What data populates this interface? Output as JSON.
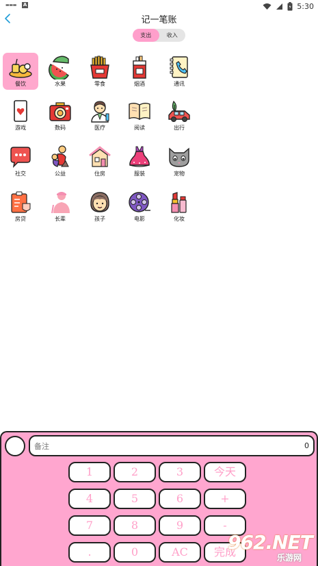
{
  "status_bar": {
    "time": "5:30",
    "left_badge": "A",
    "left_mini": "▬▬▬"
  },
  "header": {
    "title": "记一笔账"
  },
  "tabs": [
    {
      "label": "支出",
      "active": true
    },
    {
      "label": "收入",
      "active": false
    }
  ],
  "categories": [
    {
      "label": "餐饮",
      "icon": "meal-icon",
      "selected": true
    },
    {
      "label": "水果",
      "icon": "watermelon-icon",
      "selected": false
    },
    {
      "label": "零食",
      "icon": "fries-icon",
      "selected": false
    },
    {
      "label": "烟酒",
      "icon": "cigarette-icon",
      "selected": false
    },
    {
      "label": "通讯",
      "icon": "phone-book-icon",
      "selected": false
    },
    {
      "label": "游戏",
      "icon": "playing-card-icon",
      "selected": false
    },
    {
      "label": "数码",
      "icon": "camera-icon",
      "selected": false
    },
    {
      "label": "医疗",
      "icon": "doctor-icon",
      "selected": false
    },
    {
      "label": "阅读",
      "icon": "book-icon",
      "selected": false
    },
    {
      "label": "出行",
      "icon": "car-icon",
      "selected": false
    },
    {
      "label": "社交",
      "icon": "chat-bubble-icon",
      "selected": false
    },
    {
      "label": "公益",
      "icon": "charity-icon",
      "selected": false
    },
    {
      "label": "住房",
      "icon": "house-icon",
      "selected": false
    },
    {
      "label": "服装",
      "icon": "dress-icon",
      "selected": false
    },
    {
      "label": "宠物",
      "icon": "cat-icon",
      "selected": false
    },
    {
      "label": "房贷",
      "icon": "mortgage-icon",
      "selected": false
    },
    {
      "label": "长辈",
      "icon": "elder-icon",
      "selected": false
    },
    {
      "label": "孩子",
      "icon": "child-icon",
      "selected": false
    },
    {
      "label": "电影",
      "icon": "film-reel-icon",
      "selected": false
    },
    {
      "label": "化妆",
      "icon": "lipstick-icon",
      "selected": false
    }
  ],
  "keypad": {
    "note_placeholder": "备注",
    "amount": "0",
    "keys": [
      {
        "label": "1",
        "name": "key-1"
      },
      {
        "label": "2",
        "name": "key-2"
      },
      {
        "label": "3",
        "name": "key-3"
      },
      {
        "label": "今天",
        "name": "key-today"
      },
      {
        "label": "4",
        "name": "key-4"
      },
      {
        "label": "5",
        "name": "key-5"
      },
      {
        "label": "6",
        "name": "key-6"
      },
      {
        "label": "+",
        "name": "key-plus"
      },
      {
        "label": "7",
        "name": "key-7"
      },
      {
        "label": "8",
        "name": "key-8"
      },
      {
        "label": "9",
        "name": "key-9"
      },
      {
        "label": "-",
        "name": "key-minus"
      },
      {
        "label": ".",
        "name": "key-dot"
      },
      {
        "label": "0",
        "name": "key-0"
      },
      {
        "label": "AC",
        "name": "key-clear"
      },
      {
        "label": "完成",
        "name": "key-done"
      }
    ]
  },
  "watermark": {
    "big": "962.NET",
    "small": "乐游网"
  },
  "colors": {
    "accent_pink": "#ffa6cf",
    "key_text": "#ff9fc8",
    "outline": "#222222"
  }
}
